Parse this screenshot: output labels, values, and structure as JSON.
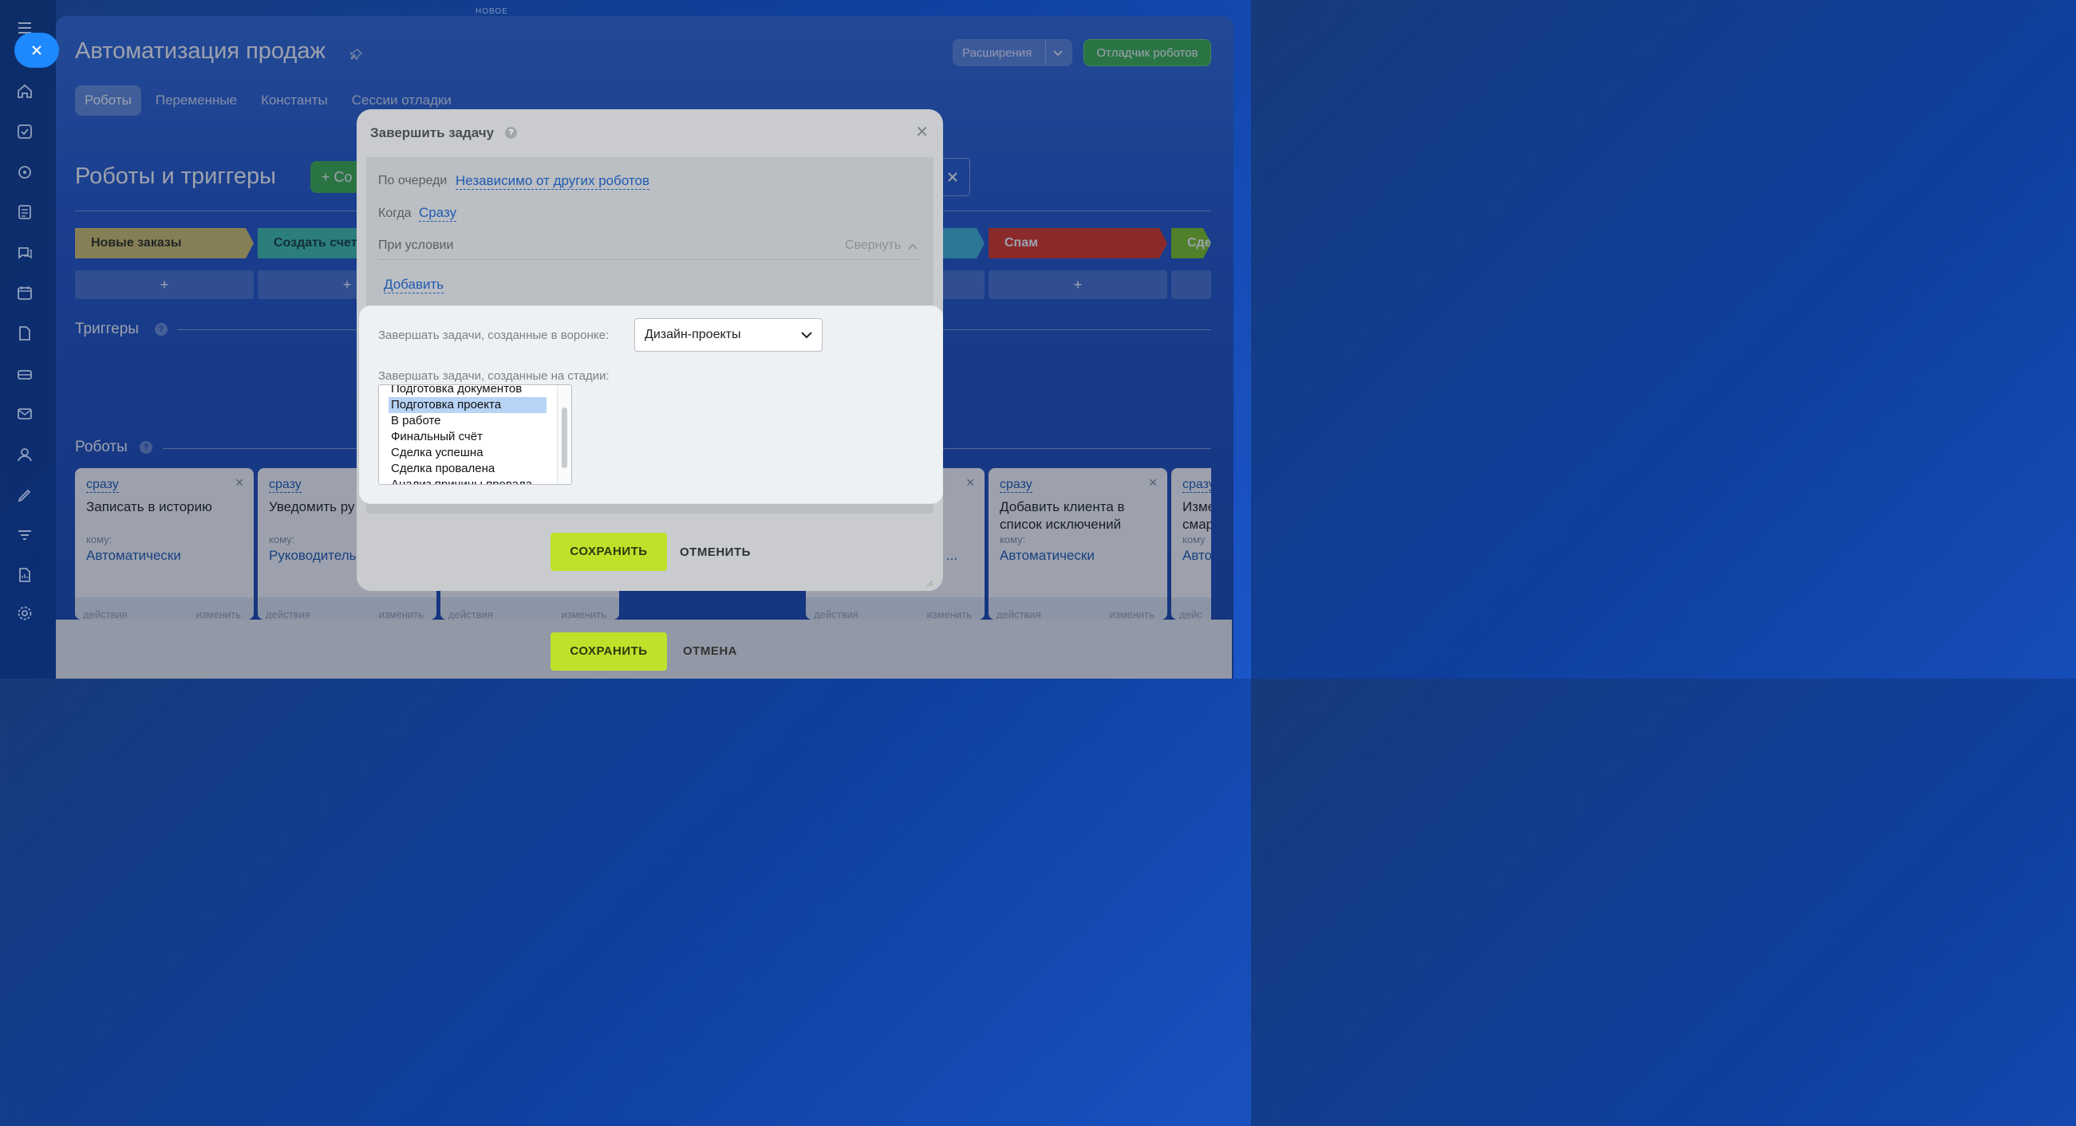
{
  "top_label": "НОВОЕ",
  "header": {
    "title": "Автоматизация продаж",
    "extensions_label": "Расширения",
    "debugger_label": "Отладчик роботов"
  },
  "tabs": [
    {
      "label": "Роботы",
      "active": true
    },
    {
      "label": "Переменные",
      "active": false
    },
    {
      "label": "Константы",
      "active": false
    },
    {
      "label": "Сессии отладки",
      "active": false
    }
  ],
  "section": {
    "title": "Роботы и триггеры",
    "create_label": "+ Со"
  },
  "stages": [
    {
      "label": "Новые заказы",
      "color": "#d9c56a",
      "text_color": "#2c2a17"
    },
    {
      "label": "Создать счет",
      "color": "#3ec3ad",
      "text_color": "#113b35"
    },
    {
      "label": "",
      "color": "#3fb6d8",
      "text_color": "#ffffff"
    },
    {
      "label": "Спам",
      "color": "#e2321f",
      "text_color": "#ffffff"
    },
    {
      "label": "Сде",
      "color": "#7cc61d",
      "text_color": "#ffffff"
    }
  ],
  "plus_label": "+",
  "triggers_title": "Триггеры",
  "robots_title": "Роботы",
  "cards": [
    {
      "when": "сразу",
      "name": "Записать в историю",
      "to_label": "кому:",
      "who": "Автоматически",
      "foot_left": "действия",
      "foot_right": "изменить"
    },
    {
      "when": "сразу",
      "name": "Уведомить ру",
      "to_label": "кому:",
      "who": "Руководитель",
      "foot_left": "действия",
      "foot_right": "изменить"
    },
    {
      "when": "",
      "name": "",
      "to_label": "",
      "who": "",
      "foot_left": "действия",
      "foot_right": "изменить"
    },
    {
      "when": "",
      "name": "",
      "to_label": "",
      "who": "...",
      "foot_left": "действия",
      "foot_right": "изменить"
    },
    {
      "when": "сразу",
      "name": "Добавить клиента в список исключений",
      "to_label": "кому:",
      "who": "Автоматически",
      "foot_left": "действия",
      "foot_right": "изменить"
    },
    {
      "when": "сразу",
      "name": "Изме смар",
      "to_label": "кому",
      "who": "Авто",
      "foot_left": "дейс",
      "foot_right": ""
    }
  ],
  "bottom": {
    "save_label": "СОХРАНИТЬ",
    "cancel_label": "ОТМЕНА"
  },
  "dialog": {
    "title": "Завершить задачу",
    "queue_label": "По очереди",
    "queue_value": "Независимо от других роботов",
    "when_label": "Когда",
    "when_value": "Сразу",
    "condition_label": "При условии",
    "collapse_label": "Свернуть",
    "add_label": "Добавить",
    "funnel_label": "Завершать задачи, созданные в воронке:",
    "funnel_value": "Дизайн-проекты",
    "stage_label": "Завершать задачи, созданные на стадии:",
    "stage_options": [
      "Подготовка документов",
      "Подготовка проекта",
      "В работе",
      "Финальный счёт",
      "Сделка успешна",
      "Сделка провалена",
      "Анализ причины провала"
    ],
    "selected_option": "Подготовка проекта",
    "save_label": "СОХРАНИТЬ",
    "cancel_label": "ОТМЕНИТЬ"
  }
}
